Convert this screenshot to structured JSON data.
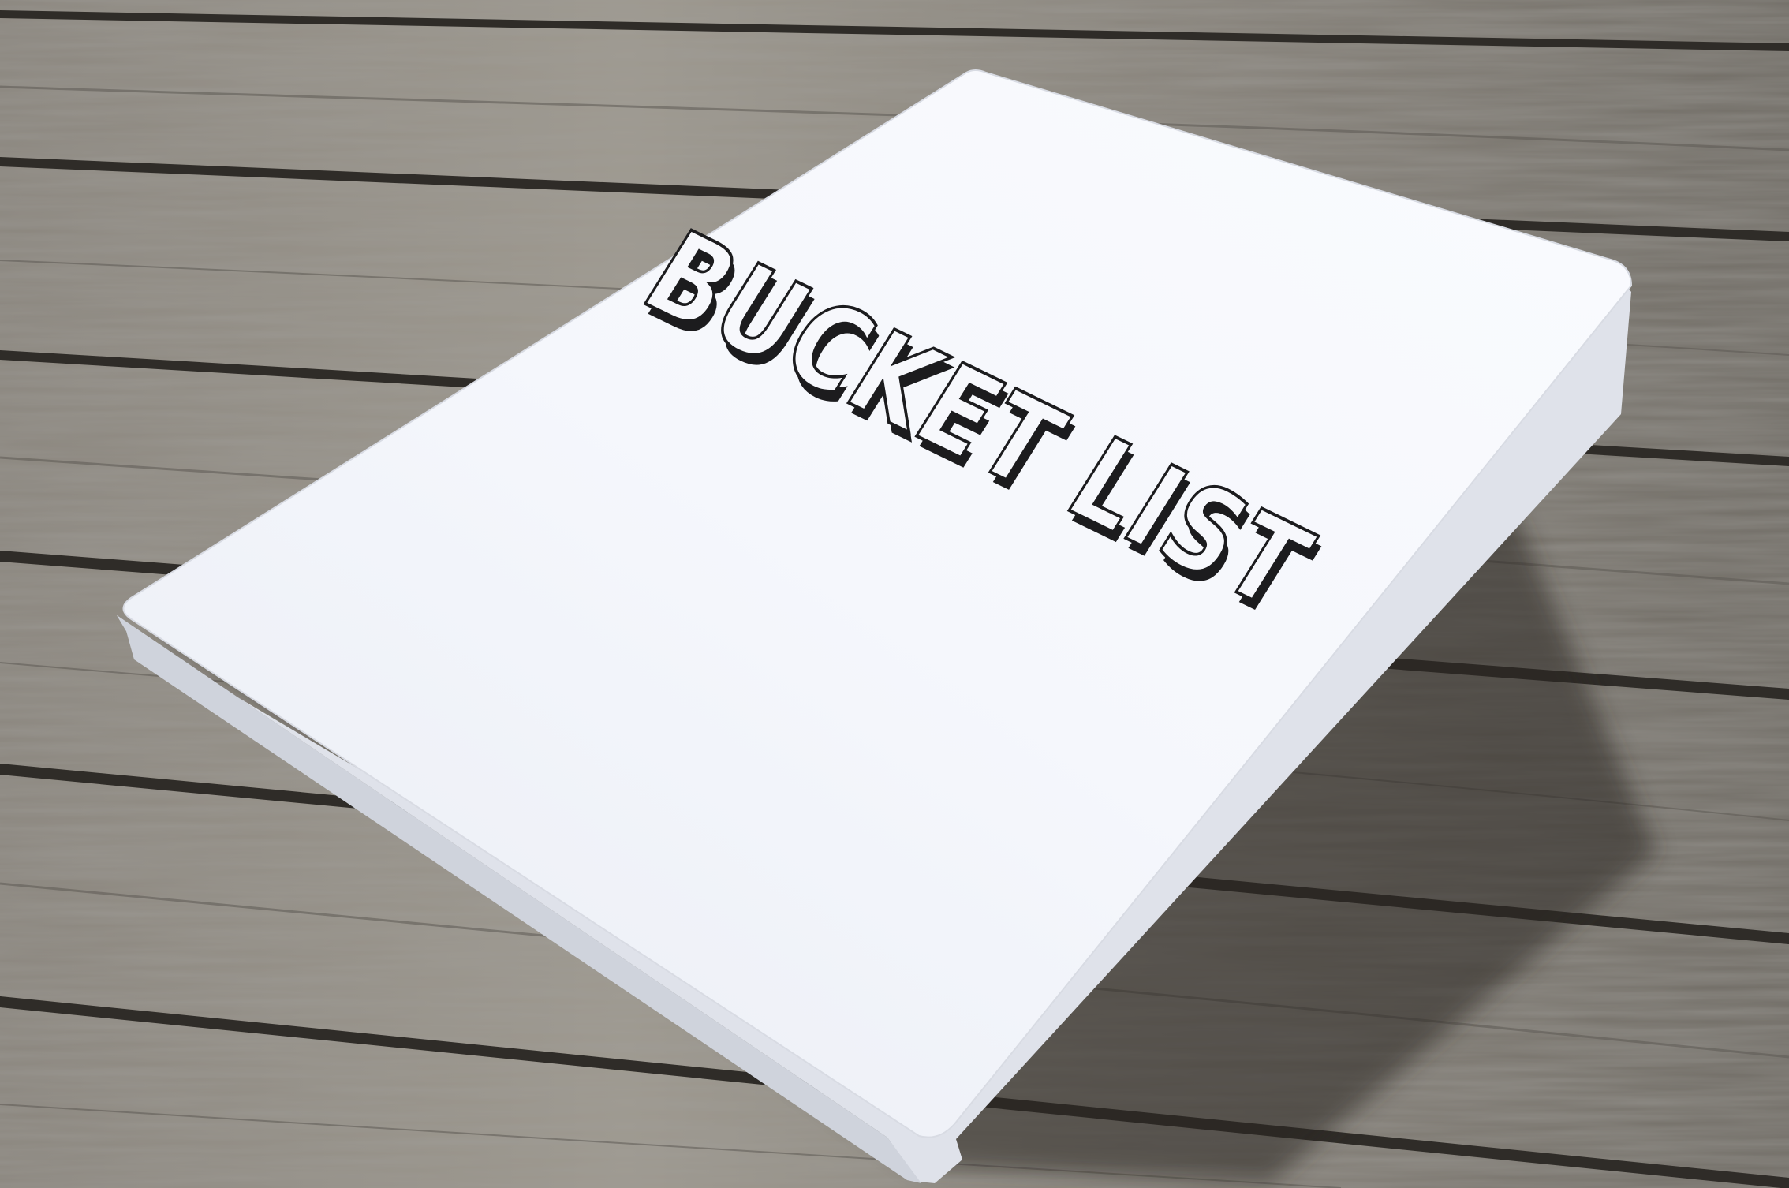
{
  "scene": {
    "subject": "notebook",
    "surface": "wooden-table"
  },
  "notebook": {
    "cover_title": "BUCKET LIST",
    "cover_color": "#f4f6fb",
    "edge_color": "#e6e8ef",
    "ink_color": "#1c1c1e"
  },
  "colors": {
    "wood_light": "#9a958d",
    "wood_mid": "#7a766f",
    "wood_dark": "#4e4b46",
    "gap": "#2a2825"
  }
}
